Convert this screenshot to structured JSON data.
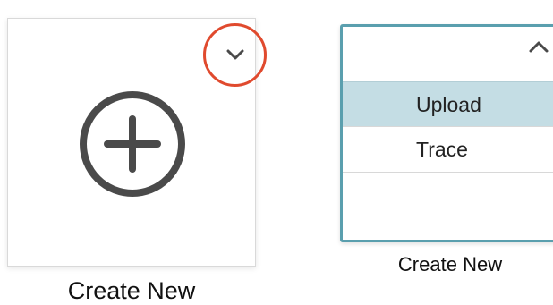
{
  "colors": {
    "highlight_ring": "#e04a2e",
    "active_border": "#5a9fae",
    "menu_highlight": "#c4dde4",
    "icon_gray": "#4a4a4a"
  },
  "cards": [
    {
      "state": "collapsed",
      "label": "Create New",
      "icon": "plus-circle-icon",
      "toggle_icon": "chevron-down-icon"
    },
    {
      "state": "expanded",
      "label": "Create New",
      "toggle_icon": "chevron-up-icon",
      "menu": {
        "highlighted": "Upload",
        "items": [
          "Upload",
          "Trace"
        ]
      }
    }
  ]
}
